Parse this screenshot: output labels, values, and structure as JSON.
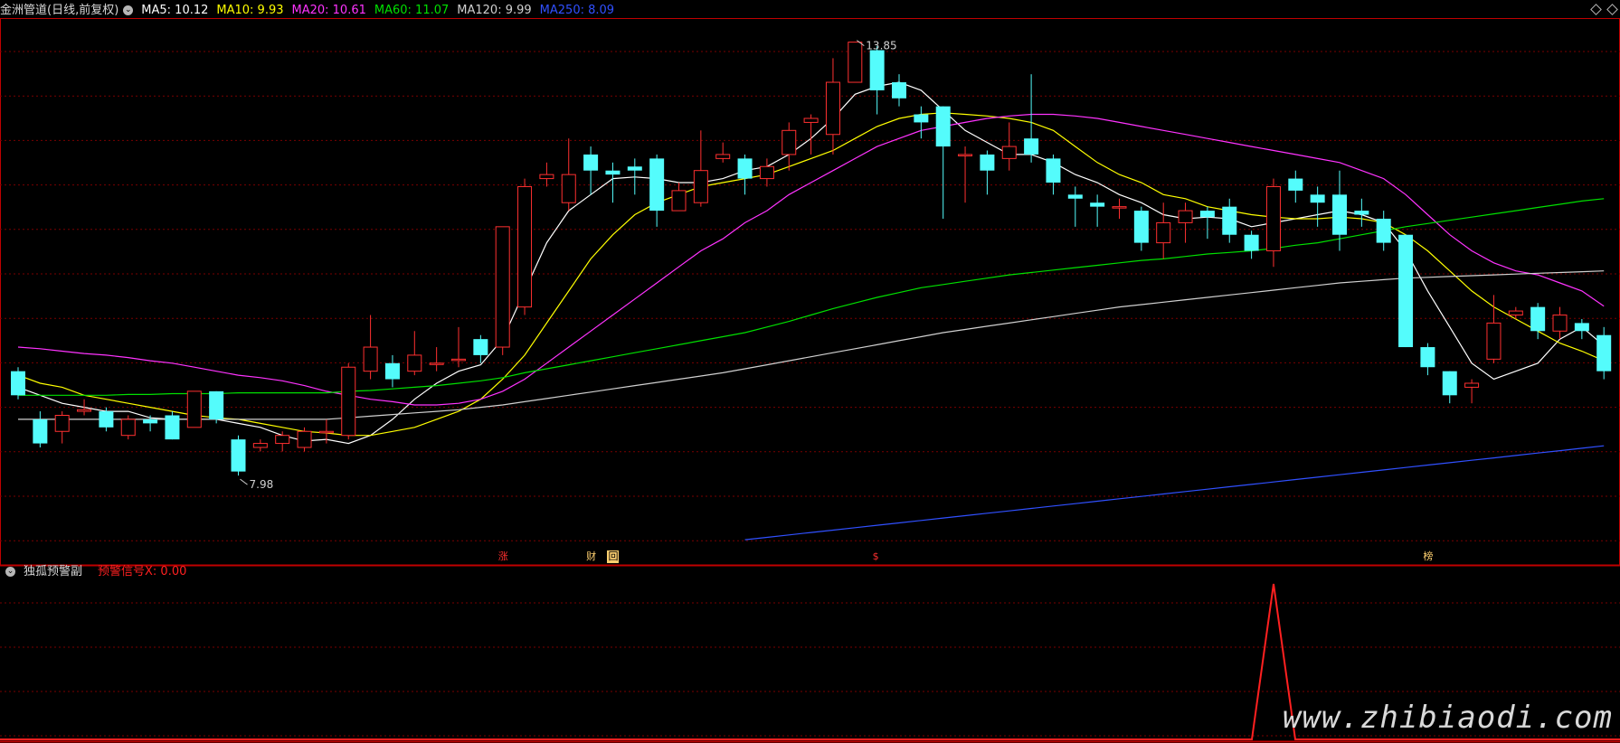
{
  "header": {
    "stock_title": "金洲管道(日线,前复权)",
    "ma": [
      {
        "label": "MA5: 10.12",
        "color": "#ffffff"
      },
      {
        "label": "MA10: 9.93",
        "color": "#ffff00"
      },
      {
        "label": "MA20: 10.61",
        "color": "#ff33ff"
      },
      {
        "label": "MA60: 11.07",
        "color": "#00e000"
      },
      {
        "label": "MA120: 9.99",
        "color": "#d0d0d0"
      },
      {
        "label": "MA250: 8.09",
        "color": "#3050ff"
      }
    ]
  },
  "subpanel": {
    "title": "独孤预警副",
    "signal_label": "预警信号X: 0.00",
    "signal_color": "#ff2020"
  },
  "markers": [
    {
      "text": "涨",
      "color": "#ff3030",
      "bg": "#000000",
      "idx": 22
    },
    {
      "text": "财",
      "color": "#ffd070",
      "bg": "#000000",
      "idx": 26
    },
    {
      "text": "回",
      "color": "#000000",
      "bg": "#ffd070",
      "idx": 27
    },
    {
      "text": "$",
      "color": "#ff3030",
      "bg": "#000000",
      "idx": 39
    },
    {
      "text": "榜",
      "color": "#ffd070",
      "bg": "#000000",
      "idx": 64
    }
  ],
  "watermark": "www.zhibiaodi.com",
  "colors": {
    "up": "#ff3030",
    "down": "#54fcfc",
    "grid": "#7a0000",
    "border": "#c00000"
  },
  "chart_data": {
    "type": "candlestick",
    "price_range": [
      7.6,
      14.2
    ],
    "annotations": {
      "high": "13.85",
      "low": "7.98"
    },
    "candles": [
      [
        9.8,
        9.5,
        9.85,
        9.45
      ],
      [
        9.2,
        8.9,
        9.3,
        8.85
      ],
      [
        9.05,
        9.25,
        9.3,
        8.9
      ],
      [
        9.3,
        9.32,
        9.45,
        9.25
      ],
      [
        9.3,
        9.1,
        9.35,
        9.05
      ],
      [
        9.0,
        9.2,
        9.25,
        8.95
      ],
      [
        9.2,
        9.15,
        9.25,
        9.05
      ],
      [
        9.25,
        8.95,
        9.3,
        8.95
      ],
      [
        9.1,
        9.55,
        9.55,
        9.1
      ],
      [
        9.55,
        9.2,
        9.55,
        9.15
      ],
      [
        8.95,
        8.55,
        9.0,
        8.5
      ],
      [
        8.85,
        8.9,
        8.95,
        8.8
      ],
      [
        8.9,
        9.0,
        9.05,
        8.8
      ],
      [
        8.85,
        9.05,
        9.1,
        8.8
      ],
      [
        9.05,
        9.05,
        9.2,
        8.9
      ],
      [
        9.0,
        9.85,
        9.9,
        8.95
      ],
      [
        9.8,
        10.1,
        10.5,
        9.7
      ],
      [
        9.9,
        9.7,
        10.0,
        9.6
      ],
      [
        9.8,
        10.0,
        10.3,
        9.75
      ],
      [
        9.9,
        9.9,
        10.1,
        9.8
      ],
      [
        9.95,
        9.95,
        10.35,
        9.85
      ],
      [
        10.2,
        10.0,
        10.25,
        9.9
      ],
      [
        10.1,
        11.6,
        11.6,
        10.0
      ],
      [
        10.6,
        12.1,
        12.2,
        10.5
      ],
      [
        12.2,
        12.25,
        12.4,
        12.1
      ],
      [
        11.9,
        12.25,
        12.7,
        11.8
      ],
      [
        12.5,
        12.3,
        12.6,
        12.0
      ],
      [
        12.3,
        12.25,
        12.4,
        11.9
      ],
      [
        12.35,
        12.3,
        12.45,
        12.0
      ],
      [
        12.45,
        11.8,
        12.5,
        11.6
      ],
      [
        11.8,
        12.05,
        12.15,
        11.8
      ],
      [
        11.9,
        12.3,
        12.8,
        11.85
      ],
      [
        12.45,
        12.5,
        12.65,
        12.4
      ],
      [
        12.45,
        12.2,
        12.5,
        12.0
      ],
      [
        12.2,
        12.35,
        12.45,
        12.1
      ],
      [
        12.5,
        12.8,
        12.9,
        12.3
      ],
      [
        12.9,
        12.95,
        13.0,
        12.5
      ],
      [
        12.75,
        13.4,
        13.7,
        12.5
      ],
      [
        13.4,
        13.9,
        13.9,
        13.4
      ],
      [
        13.8,
        13.3,
        13.85,
        13.0
      ],
      [
        13.4,
        13.2,
        13.5,
        13.1
      ],
      [
        13.0,
        12.9,
        13.1,
        12.7
      ],
      [
        13.1,
        12.6,
        13.1,
        11.7
      ],
      [
        12.5,
        12.5,
        12.6,
        11.9
      ],
      [
        12.5,
        12.3,
        12.55,
        12.0
      ],
      [
        12.45,
        12.6,
        12.9,
        12.3
      ],
      [
        12.7,
        12.5,
        13.5,
        12.4
      ],
      [
        12.45,
        12.15,
        12.5,
        12.0
      ],
      [
        12.0,
        11.95,
        12.1,
        11.6
      ],
      [
        11.9,
        11.85,
        12.0,
        11.6
      ],
      [
        11.85,
        11.85,
        11.95,
        11.7
      ],
      [
        11.8,
        11.4,
        11.85,
        11.3
      ],
      [
        11.4,
        11.65,
        11.9,
        11.2
      ],
      [
        11.65,
        11.8,
        11.9,
        11.4
      ],
      [
        11.8,
        11.72,
        11.85,
        11.45
      ],
      [
        11.85,
        11.5,
        11.95,
        11.4
      ],
      [
        11.5,
        11.3,
        11.55,
        11.2
      ],
      [
        11.3,
        12.1,
        12.2,
        11.1
      ],
      [
        12.2,
        12.05,
        12.3,
        11.9
      ],
      [
        12.0,
        11.9,
        12.1,
        11.6
      ],
      [
        12.0,
        11.5,
        12.3,
        11.3
      ],
      [
        11.8,
        11.75,
        11.95,
        11.6
      ],
      [
        11.7,
        11.4,
        11.8,
        11.3
      ],
      [
        11.5,
        10.1,
        11.5,
        10.1
      ],
      [
        10.1,
        9.85,
        10.15,
        9.75
      ],
      [
        9.8,
        9.5,
        9.8,
        9.4
      ],
      [
        9.6,
        9.65,
        9.7,
        9.4
      ],
      [
        9.95,
        10.4,
        10.75,
        9.9
      ],
      [
        10.5,
        10.55,
        10.6,
        10.45
      ],
      [
        10.6,
        10.3,
        10.65,
        10.2
      ],
      [
        10.3,
        10.5,
        10.6,
        10.2
      ],
      [
        10.4,
        10.3,
        10.45,
        10.2
      ],
      [
        10.25,
        9.8,
        10.35,
        9.7
      ]
    ],
    "ma_series": [
      {
        "name": "MA5",
        "color": "#ffffff",
        "values": [
          9.6,
          9.5,
          9.4,
          9.35,
          9.3,
          9.3,
          9.22,
          9.2,
          9.2,
          9.2,
          9.15,
          9.1,
          9.0,
          8.93,
          8.95,
          8.9,
          9.0,
          9.2,
          9.45,
          9.65,
          9.8,
          9.88,
          10.2,
          10.8,
          11.4,
          11.8,
          12.0,
          12.2,
          12.22,
          12.2,
          12.15,
          12.15,
          12.2,
          12.3,
          12.35,
          12.5,
          12.7,
          12.95,
          13.25,
          13.35,
          13.4,
          13.3,
          13.05,
          12.8,
          12.65,
          12.5,
          12.5,
          12.4,
          12.25,
          12.15,
          12.0,
          11.9,
          11.75,
          11.7,
          11.72,
          11.7,
          11.6,
          11.65,
          11.7,
          11.75,
          11.8,
          11.75,
          11.65,
          11.3,
          10.8,
          10.35,
          9.9,
          9.7,
          9.8,
          9.9,
          10.2,
          10.35,
          10.12
        ]
      },
      {
        "name": "MA10",
        "color": "#ffff00",
        "values": [
          9.75,
          9.65,
          9.6,
          9.5,
          9.45,
          9.4,
          9.35,
          9.3,
          9.25,
          9.22,
          9.2,
          9.15,
          9.1,
          9.05,
          9.03,
          9.0,
          9.0,
          9.05,
          9.1,
          9.2,
          9.3,
          9.45,
          9.7,
          10.0,
          10.4,
          10.8,
          11.2,
          11.5,
          11.75,
          11.9,
          12.0,
          12.1,
          12.15,
          12.2,
          12.25,
          12.35,
          12.45,
          12.55,
          12.7,
          12.85,
          12.95,
          13.0,
          13.02,
          13.0,
          12.98,
          12.95,
          12.9,
          12.8,
          12.6,
          12.4,
          12.25,
          12.15,
          12.0,
          11.95,
          11.85,
          11.8,
          11.75,
          11.72,
          11.7,
          11.7,
          11.72,
          11.7,
          11.65,
          11.5,
          11.3,
          11.05,
          10.8,
          10.6,
          10.45,
          10.3,
          10.15,
          10.05,
          9.93
        ]
      },
      {
        "name": "MA20",
        "color": "#ff33ff",
        "values": [
          10.1,
          10.08,
          10.05,
          10.02,
          10.0,
          9.97,
          9.93,
          9.9,
          9.85,
          9.8,
          9.75,
          9.72,
          9.68,
          9.62,
          9.55,
          9.5,
          9.45,
          9.42,
          9.38,
          9.38,
          9.4,
          9.45,
          9.55,
          9.7,
          9.9,
          10.1,
          10.3,
          10.5,
          10.7,
          10.9,
          11.1,
          11.3,
          11.45,
          11.65,
          11.8,
          12.0,
          12.15,
          12.3,
          12.45,
          12.6,
          12.7,
          12.8,
          12.85,
          12.9,
          12.95,
          12.98,
          13.0,
          13.0,
          12.98,
          12.95,
          12.9,
          12.85,
          12.8,
          12.75,
          12.7,
          12.65,
          12.6,
          12.55,
          12.5,
          12.45,
          12.4,
          12.3,
          12.2,
          12.0,
          11.75,
          11.5,
          11.3,
          11.15,
          11.05,
          11.0,
          10.9,
          10.8,
          10.61
        ]
      },
      {
        "name": "MA60",
        "color": "#00e000",
        "values": [
          9.5,
          9.5,
          9.5,
          9.5,
          9.5,
          9.51,
          9.51,
          9.52,
          9.52,
          9.52,
          9.53,
          9.53,
          9.53,
          9.53,
          9.53,
          9.55,
          9.56,
          9.58,
          9.6,
          9.62,
          9.65,
          9.68,
          9.72,
          9.78,
          9.83,
          9.88,
          9.93,
          9.98,
          10.03,
          10.08,
          10.13,
          10.18,
          10.23,
          10.28,
          10.35,
          10.42,
          10.5,
          10.58,
          10.65,
          10.72,
          10.78,
          10.84,
          10.88,
          10.92,
          10.96,
          11.0,
          11.03,
          11.06,
          11.09,
          11.12,
          11.15,
          11.18,
          11.2,
          11.23,
          11.26,
          11.28,
          11.3,
          11.33,
          11.37,
          11.4,
          11.45,
          11.5,
          11.55,
          11.6,
          11.64,
          11.68,
          11.72,
          11.76,
          11.8,
          11.84,
          11.88,
          11.92,
          11.95
        ]
      },
      {
        "name": "MA120",
        "color": "#d0d0d0",
        "values": [
          9.2,
          9.2,
          9.2,
          9.2,
          9.2,
          9.2,
          9.2,
          9.2,
          9.2,
          9.2,
          9.2,
          9.2,
          9.2,
          9.2,
          9.2,
          9.22,
          9.24,
          9.26,
          9.28,
          9.3,
          9.32,
          9.35,
          9.38,
          9.42,
          9.46,
          9.5,
          9.54,
          9.58,
          9.62,
          9.66,
          9.7,
          9.74,
          9.78,
          9.83,
          9.88,
          9.93,
          9.98,
          10.03,
          10.08,
          10.13,
          10.18,
          10.23,
          10.28,
          10.32,
          10.36,
          10.4,
          10.44,
          10.48,
          10.52,
          10.56,
          10.6,
          10.63,
          10.66,
          10.69,
          10.72,
          10.75,
          10.78,
          10.81,
          10.84,
          10.87,
          10.9,
          10.92,
          10.94,
          10.96,
          10.97,
          10.98,
          10.99,
          11.0,
          11.01,
          11.02,
          11.03,
          11.04,
          11.05
        ]
      },
      {
        "name": "MA250",
        "color": "#3050ff",
        "values": [
          null,
          null,
          null,
          null,
          null,
          null,
          null,
          null,
          null,
          null,
          null,
          null,
          null,
          null,
          null,
          null,
          null,
          null,
          null,
          null,
          null,
          null,
          null,
          null,
          null,
          null,
          null,
          null,
          null,
          null,
          null,
          null,
          null,
          7.7,
          7.73,
          7.76,
          7.79,
          7.82,
          7.85,
          7.88,
          7.91,
          7.94,
          7.97,
          8.0,
          8.03,
          8.06,
          8.09,
          8.12,
          8.15,
          8.18,
          8.21,
          8.24,
          8.27,
          8.3,
          8.33,
          8.36,
          8.39,
          8.42,
          8.45,
          8.48,
          8.51,
          8.54,
          8.57,
          8.6,
          8.63,
          8.66,
          8.69,
          8.72,
          8.75,
          8.78,
          8.81,
          8.84,
          8.87
        ]
      }
    ],
    "signal": {
      "values_nonzero": [
        {
          "idx": 57,
          "value": 1
        }
      ]
    }
  }
}
